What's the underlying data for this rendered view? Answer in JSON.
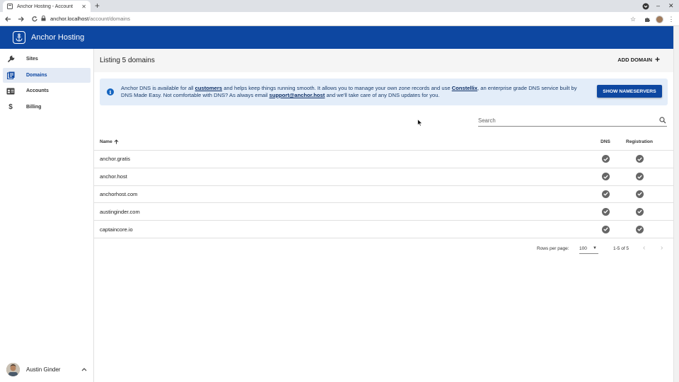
{
  "browser": {
    "tab_title": "Anchor Hosting - Account",
    "url_host": "anchor.localhost",
    "url_path": "/account/domains"
  },
  "app": {
    "title": "Anchor Hosting",
    "brand_color": "#0d47a1"
  },
  "sidebar": {
    "items": [
      {
        "label": "Sites",
        "icon": "wrench-icon",
        "active": false
      },
      {
        "label": "Domains",
        "icon": "domains-icon",
        "active": true
      },
      {
        "label": "Accounts",
        "icon": "account-card-icon",
        "active": false
      },
      {
        "label": "Billing",
        "icon": "dollar-icon",
        "active": false
      }
    ],
    "user": {
      "name": "Austin Ginder"
    }
  },
  "main": {
    "listing_title": "Listing 5 domains",
    "add_domain_label": "ADD DOMAIN",
    "alert": {
      "text_1": "Anchor DNS is available for all ",
      "link_customers": "customers",
      "text_2": " and helps keep things running smooth. It allows you to manage your own zone records and use ",
      "link_constellix": "Constellix",
      "text_3": ", an enterprise grade DNS service built by DNS Made Easy. Not comfortable with DNS? As always email ",
      "link_email": "support@anchor.host",
      "text_4": " and we'll take care of any DNS updates for you.",
      "button_label": "SHOW NAMESERVERS"
    },
    "search": {
      "placeholder": "Search"
    },
    "table": {
      "headers": {
        "name": "Name",
        "dns": "DNS",
        "registration": "Registration"
      },
      "rows": [
        {
          "name": "anchor.gratis",
          "dns": true,
          "registration": true
        },
        {
          "name": "anchor.host",
          "dns": true,
          "registration": true
        },
        {
          "name": "anchorhost.com",
          "dns": true,
          "registration": true
        },
        {
          "name": "austinginder.com",
          "dns": true,
          "registration": true
        },
        {
          "name": "captaincore.io",
          "dns": true,
          "registration": true
        }
      ]
    },
    "pagination": {
      "rows_per_page_label": "Rows per page:",
      "rows_per_page": "100",
      "range": "1-5 of 5"
    }
  }
}
